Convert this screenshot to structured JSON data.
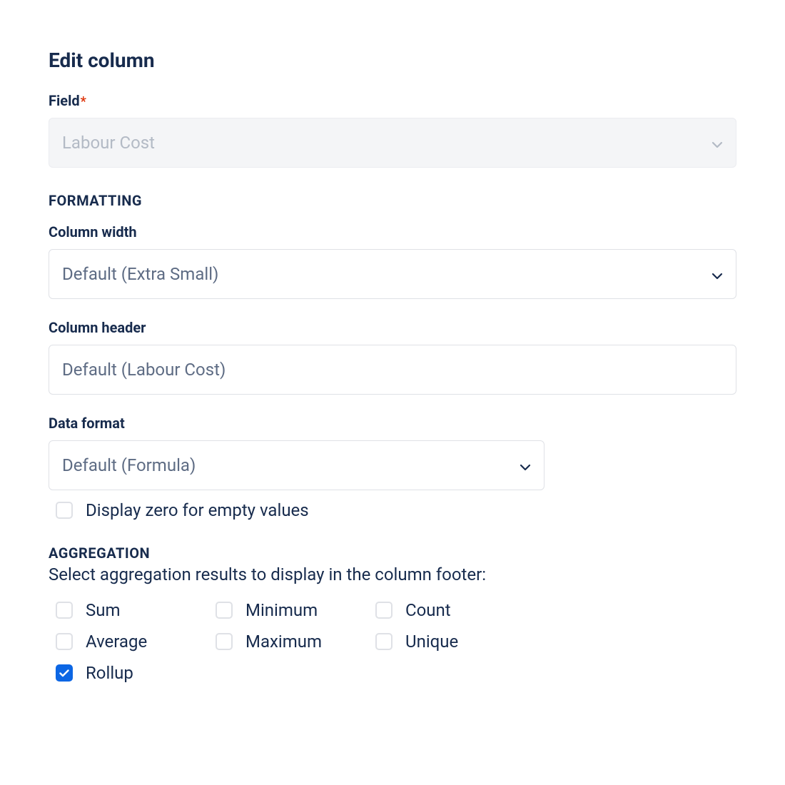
{
  "title": "Edit column",
  "field": {
    "label": "Field",
    "required_mark": "*",
    "value": "Labour Cost"
  },
  "formatting": {
    "heading": "FORMATTING",
    "column_width": {
      "label": "Column width",
      "value": "Default (Extra Small)"
    },
    "column_header": {
      "label": "Column header",
      "placeholder": "Default (Labour Cost)",
      "value": ""
    },
    "data_format": {
      "label": "Data format",
      "value": "Default (Formula)"
    },
    "display_zero_label": "Display zero for empty values"
  },
  "aggregation": {
    "heading": "AGGREGATION",
    "description": "Select aggregation results to display in the column footer:",
    "options": {
      "sum": "Sum",
      "minimum": "Minimum",
      "count": "Count",
      "average": "Average",
      "maximum": "Maximum",
      "unique": "Unique",
      "rollup": "Rollup"
    }
  }
}
